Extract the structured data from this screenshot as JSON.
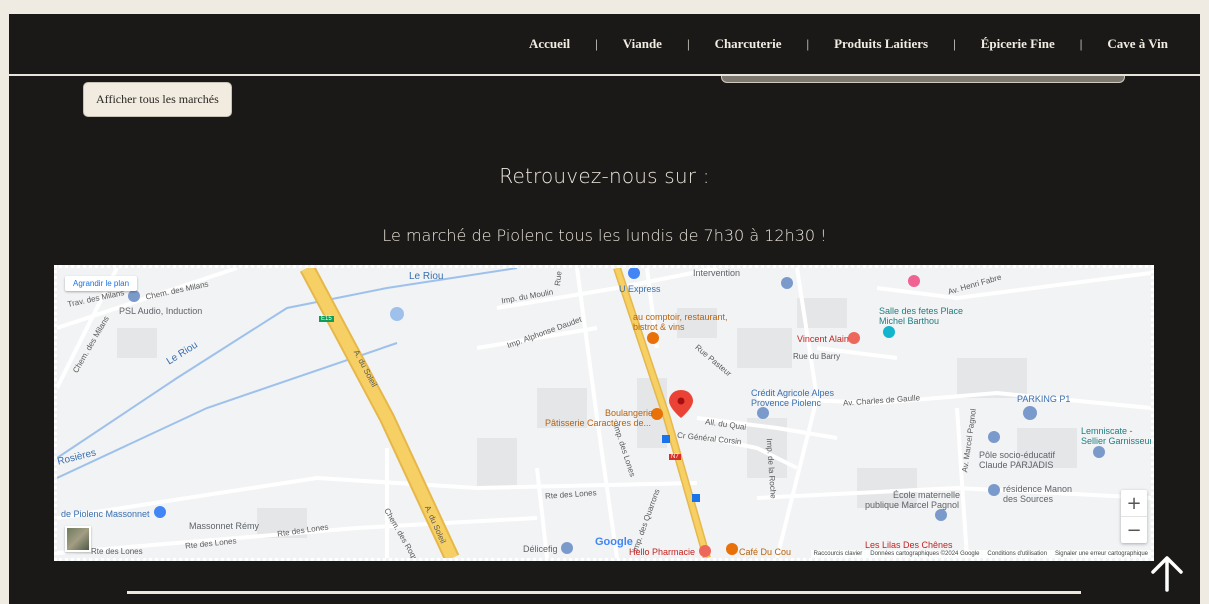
{
  "nav": {
    "items": [
      {
        "label": "Accueil"
      },
      {
        "label": "Viande"
      },
      {
        "label": "Charcuterie"
      },
      {
        "label": "Produits Laitiers"
      },
      {
        "label": "Épicerie Fine"
      },
      {
        "label": "Cave à Vin"
      }
    ],
    "separator": "|"
  },
  "markets_button": "Afficher tous les marchés",
  "find_us_title": "Retrouvez-nous sur :",
  "market_text": "Le marché de Piolenc tous les lundis de 7h30 à 12h30 !",
  "map": {
    "enlarge_label": "Agrandir le plan",
    "zoom_in": "+",
    "zoom_out": "−",
    "google": "Google",
    "attribution": {
      "shortcuts": "Raccourcis clavier",
      "data": "Données cartographiques ©2024 Google",
      "terms": "Conditions d'utilisation",
      "report": "Signaler une erreur cartographique"
    },
    "labels": {
      "riou_top": "Le Riou",
      "riou_left": "Le Riou",
      "chem_milans_1": "Chem. des Milans",
      "chem_milans_2": "Chem. des Milans",
      "trav_milans": "Trav. des Milans",
      "psl": "PSL Audio, Induction",
      "imp_moulin": "Imp. du Moulin",
      "imp_daudet": "Imp. Alphonse Daudet",
      "soleil_1": "A. du Soleil",
      "soleil_2": "A. du Soleil",
      "e15": "E15",
      "n7": "N7",
      "rosieres": "Rosières",
      "u_express": "U Express",
      "intervention": "Intervention",
      "au_comptoir": "au comptoir, restaurant,",
      "au_comptoir_2": "bistrot & vins",
      "rue_pasteur": "Rue Pasteur",
      "boulangerie": "Boulangerie",
      "patisserie": "Pâtisserie Caractères de...",
      "all_quai": "All. du Quai",
      "cr_corsin": "Cr Général Corsin",
      "imp_lones": "Imp. des Lones",
      "rte_lones_1": "Rte des Lones",
      "rte_lones_2": "Rte des Lones",
      "rte_lones_3": "Rte des Lones",
      "rte_lones_4": "Rte des Lones",
      "credit_1": "Crédit Agricole Alpes",
      "credit_2": "Provence Piolenc",
      "charles_gaulle": "Av. Charles de Gaulle",
      "vincent": "Vincent Alain",
      "rue_barry": "Rue du Barry",
      "salle_1": "Salle des fetes Place",
      "salle_2": "Michel Barthou",
      "henri_fabre": "Av. Henri Fabre",
      "parking": "PARKING P1",
      "lemniscate_1": "Lemniscate -",
      "lemniscate_2": "Sellier Garnisseur",
      "pole_1": "Pôle socio-éducatif",
      "pole_2": "Claude PARJADIS",
      "manon_1": "résidence Manon",
      "manon_2": "des Sources",
      "ecole_1": "École maternelle",
      "ecole_2": "publique Marcel Pagnol",
      "marcel_pagnol": "Av. Marcel Pagnol",
      "imp_roche": "Imp. de la Roche",
      "massonnet": "de Piolenc Massonnet",
      "massonnet_remy": "Massonnet Rémy",
      "chem_roques": "Chem. des Roques",
      "imp_quarrons": "Imp. des Quarrons",
      "delicefig": "Délicefig",
      "hello_pharmacie": "Hello Pharmacie",
      "cafe_coul": "Café Du Cou",
      "lilas": "Les Lilas Des Chênes",
      "rue_short": "Rue"
    }
  },
  "colors": {
    "background": "#1a1917",
    "page_bg": "#efebe3",
    "text_light": "#ece7dd",
    "map_road_yellow": "#f6cf65",
    "map_pin_red": "#ea4335"
  },
  "icons": {
    "scroll_top": "arrow-up-icon"
  }
}
